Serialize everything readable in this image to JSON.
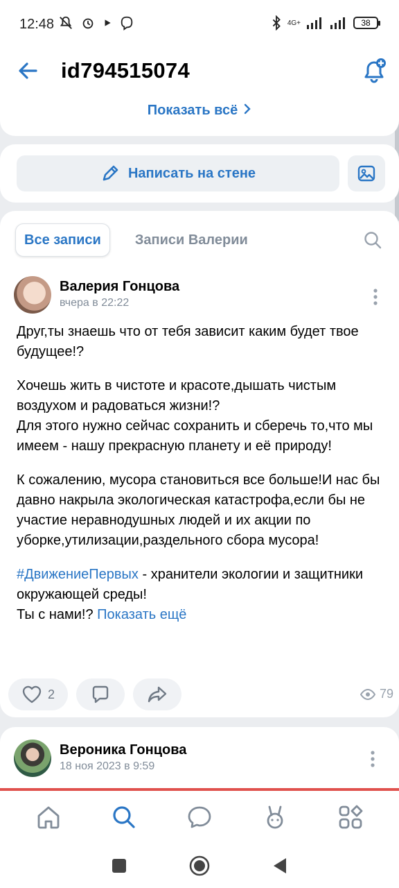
{
  "status_bar": {
    "time": "12:48",
    "battery": "38",
    "network": "4G+"
  },
  "header": {
    "title": "id794515074"
  },
  "top_card": {
    "show_all": "Показать всё"
  },
  "wall": {
    "write_label": "Написать на стене"
  },
  "tabs": [
    {
      "label": "Все записи",
      "active": true
    },
    {
      "label": "Записи Валерии",
      "active": false
    }
  ],
  "post": {
    "author": "Валерия Гонцова",
    "date": "вчера в 22:22",
    "p1": "Друг,ты знаешь что от тебя зависит каким будет твое будущее!?",
    "p2": "Хочешь жить в чистоте и красоте,дышать чистым воздухом и радоваться жизни!?\nДля этого нужно сейчас сохранить и сберечь то,что мы имеем - нашу прекрасную планету и её природу!",
    "p3": "К сожалению, мусора становиться все больше!И нас бы давно накрыла экологическая катастрофа,если бы не участие неравнодушных людей и их акции по уборке,утилизации,раздельного  сбора мусора!",
    "hashtag": "#ДвижениеПервых",
    "p4_after_hashtag": " - хранители экологии и защитники окружающей среды!",
    "p4_line2": "Ты с нами!? ",
    "show_more": "Показать ещё",
    "likes": "2",
    "views": "79"
  },
  "post2": {
    "author": "Вероника Гонцова",
    "date": "18 ноя 2023 в 9:59"
  },
  "colors": {
    "accent": "#2a76c5",
    "muted": "#818c99",
    "background": "#ebedf0"
  }
}
